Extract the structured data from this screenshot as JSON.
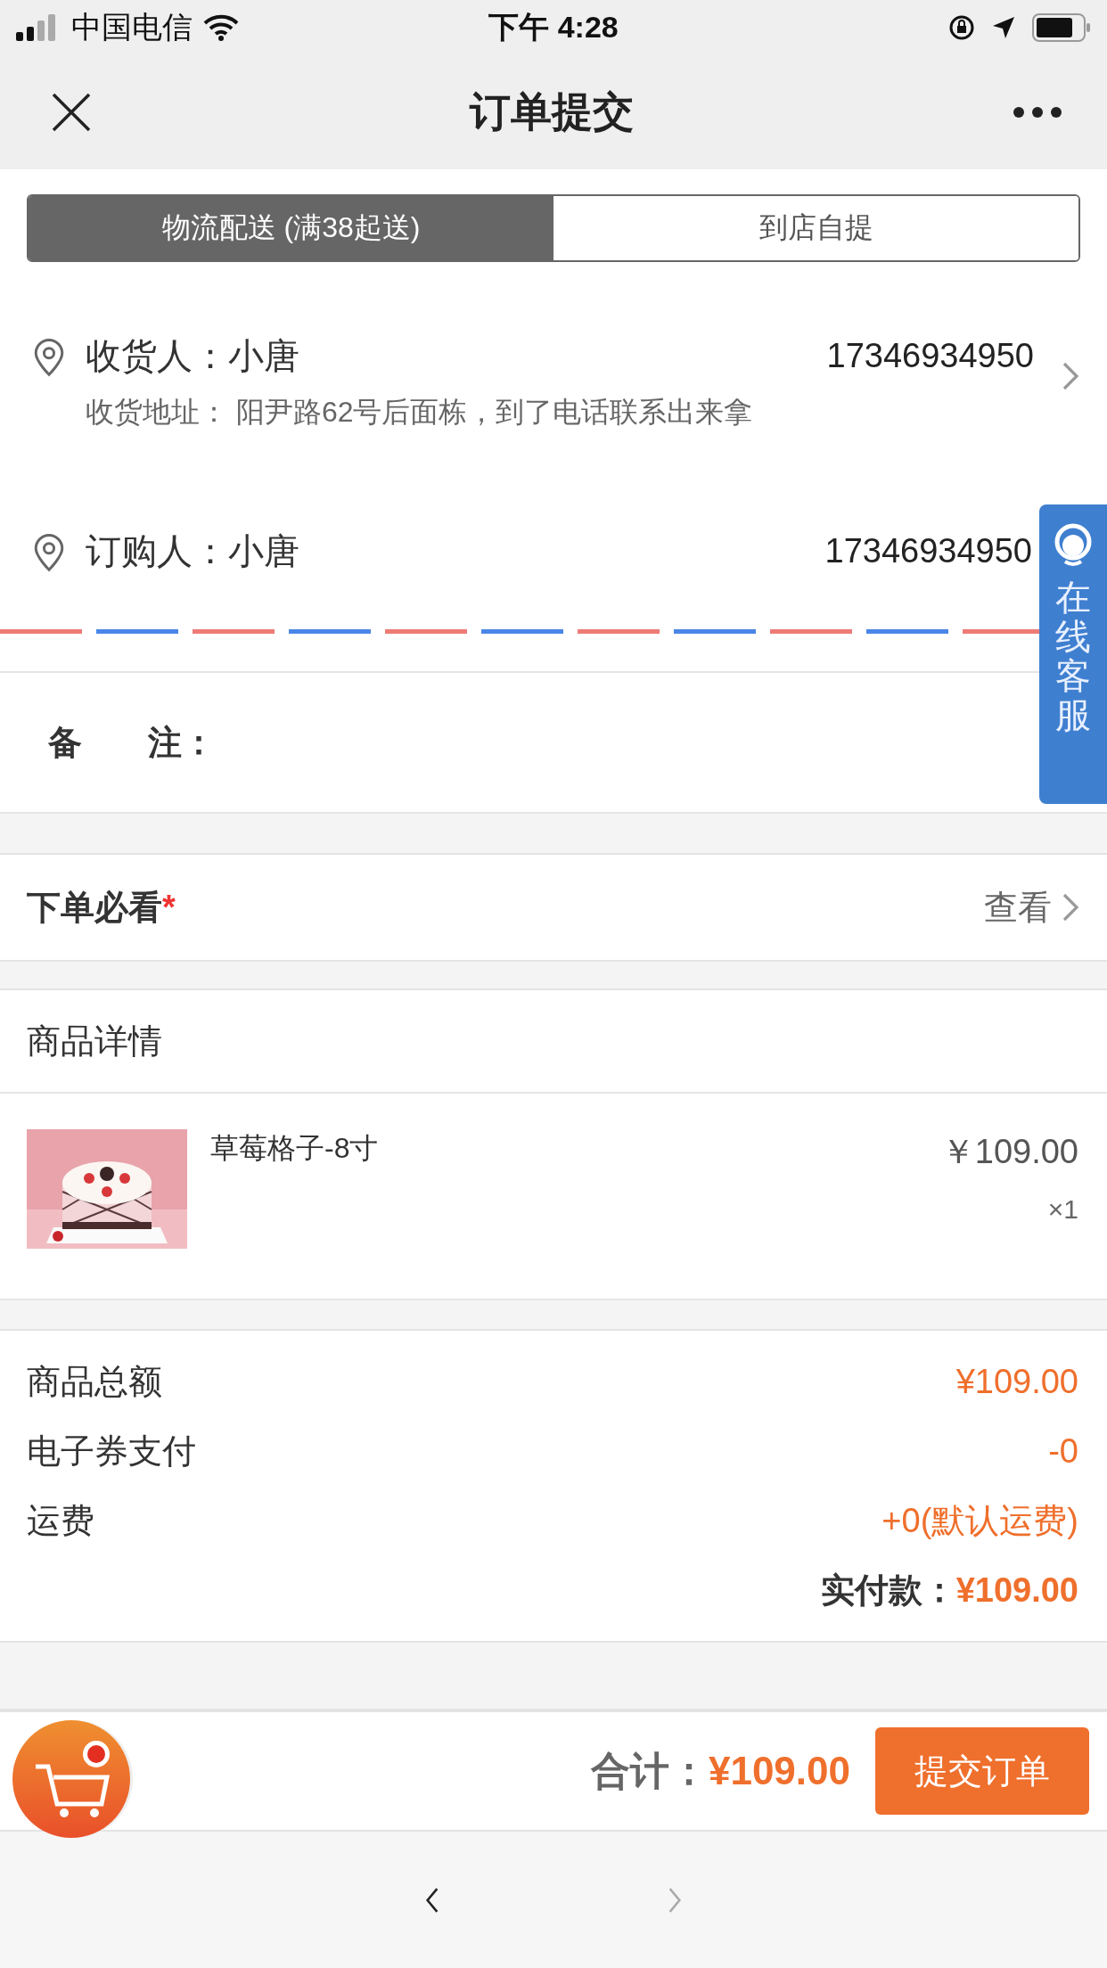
{
  "status_bar": {
    "carrier": "中国电信",
    "time": "下午 4:28"
  },
  "nav": {
    "title": "订单提交"
  },
  "delivery_tabs": [
    {
      "label": "物流配送 (满38起送)",
      "selected": true
    },
    {
      "label": "到店自提",
      "selected": false
    }
  ],
  "receiver": {
    "label": "收货人：小唐",
    "phone": "17346934950",
    "address": "收货地址： 阳尹路62号后面栋，到了电话联系出来拿"
  },
  "orderer": {
    "label": "订购人：小唐",
    "phone": "17346934950"
  },
  "remarks": {
    "label_1": "备",
    "label_2": "注："
  },
  "notice": {
    "title": "下单必看",
    "mark": "*",
    "action": "查看"
  },
  "products": {
    "header": "商品详情",
    "items": [
      {
        "kind": "picture",
        "name": "草莓格子-8寸",
        "price": "￥109.00",
        "quantity": "×1"
      }
    ]
  },
  "summary": {
    "rows": [
      {
        "label": "商品总额",
        "value": "¥109.00"
      },
      {
        "label": "电子券支付",
        "value": "-0"
      },
      {
        "label": "运费",
        "value": "+0(默认运费)"
      }
    ],
    "total_label": "实付款：",
    "total": "¥109.00"
  },
  "service_tab": {
    "label": "在线客服"
  },
  "footer": {
    "total_label": "合计：",
    "total": "¥109.00",
    "submit": "提交订单"
  },
  "browser_nav": [
    {
      "kind": "back",
      "disabled": false
    },
    {
      "kind": "forward",
      "disabled": true
    }
  ]
}
